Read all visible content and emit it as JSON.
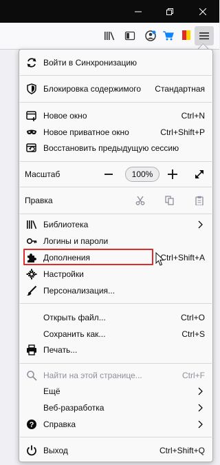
{
  "window": {
    "minimize_label": "minimize",
    "restore_label": "restore",
    "close_label": "close"
  },
  "toolbar": {
    "icons": [
      "library-icon",
      "sidebar-icon",
      "account-icon",
      "cart-icon",
      "bookmark-flag-icon",
      "hamburger-menu-icon"
    ]
  },
  "menu": {
    "sync": "Войти в Синхронизацию",
    "content_blocking": {
      "label": "Блокировка содержимого",
      "value": "Стандартная"
    },
    "new_window": {
      "label": "Новое окно",
      "shortcut": "Ctrl+N"
    },
    "new_private": {
      "label": "Новое приватное окно",
      "shortcut": "Ctrl+Shift+P"
    },
    "restore_session": "Восстановить предыдущую сессию",
    "zoom": {
      "label": "Масштаб",
      "value": "100%"
    },
    "edit": "Правка",
    "library": "Библиотека",
    "logins": "Логины и пароли",
    "addons": {
      "label": "Дополнения",
      "shortcut": "Ctrl+Shift+A"
    },
    "settings": "Настройки",
    "customize": "Персонализация...",
    "open_file": {
      "label": "Открыть файл...",
      "shortcut": "Ctrl+O"
    },
    "save_as": {
      "label": "Сохранить как...",
      "shortcut": "Ctrl+S"
    },
    "print": "Печать...",
    "find": {
      "label": "Найти на этой странице...",
      "shortcut": "Ctrl+F"
    },
    "more": "Ещё",
    "web_dev": "Веб-разработка",
    "help": "Справка",
    "exit": {
      "label": "Выход",
      "shortcut": "Ctrl+Shift+Q"
    }
  },
  "colors": {
    "highlight_border": "#e02a2a",
    "titlebar": "#0c0c0d"
  }
}
